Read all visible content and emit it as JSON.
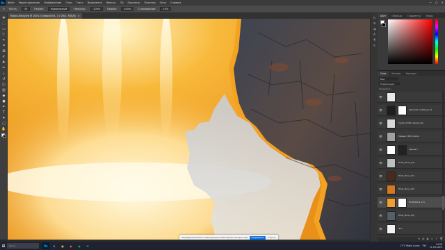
{
  "menubar": {
    "logo": "Ps",
    "items": [
      "Файл",
      "Редактирование",
      "Изображение",
      "Слои",
      "Текст",
      "Выделение",
      "Фильтр",
      "3D",
      "Просмотр",
      "Плагины",
      "Окно",
      "Справка"
    ],
    "controls": [
      "—",
      "▢",
      "✕"
    ]
  },
  "options": {
    "tool_label": "Кисть:",
    "size": "35",
    "mode_label": "Режим:",
    "mode": "Нормальный",
    "opacity_label": "Непрозр.:",
    "opacity": "100%",
    "flow_label": "Нажим:",
    "flow": "100%",
    "smoothing_label": "Сглаживание:",
    "smoothing": "10%"
  },
  "document": {
    "tab_title": "Rodion-Bleloyard @ 100% (Снимок0004, 1:1 0001, RGB/8)",
    "close": "×"
  },
  "color_panel": {
    "tabs": [
      "Цвет",
      "Образцы",
      "Градиенты",
      "Узоры"
    ],
    "fg_color": "#ffffff",
    "bg_color": "#000000"
  },
  "layers_panel": {
    "tabs": [
      "Слои",
      "Каналы",
      "Контуры"
    ],
    "filter": "Вид",
    "blend_mode": "Нормальный",
    "lock_label": "Закрепить:",
    "layers": [
      {
        "name": "",
        "thumb": "#e9e9e9",
        "mask": "",
        "selected": false
      },
      {
        "name": "Цветовой тон/Насыщ 10",
        "thumb": "#1e1e1e",
        "mask": "#ffffff",
        "selected": false
      },
      {
        "name": "Группа 2 000_original color",
        "thumb": "#d8d8d8",
        "mask": "",
        "selected": false
      },
      {
        "name": "Кривые 1 000_original",
        "thumb": "#a0a0a0",
        "mask": "",
        "selected": false
      },
      {
        "name": "Кривые 1",
        "thumb": "#ffffff",
        "mask": "#222222",
        "selected": false
      },
      {
        "name": "Photo_Stone_1(4)",
        "thumb": "#c0c0c0",
        "mask": "",
        "selected": false
      },
      {
        "name": "Photo_Stone_1(5)",
        "thumb": "#4a2a18",
        "mask": "",
        "selected": false
      },
      {
        "name": "Photo_Stone_1(6)",
        "thumb": "#d27a22",
        "mask": "",
        "selected": false
      },
      {
        "name": "PhotoMarble_1(7)",
        "thumb": "#f0a030",
        "mask": "#ffffff",
        "selected": true
      },
      {
        "name": "Photo_Stone_1(8)",
        "thumb": "#56606c",
        "mask": "",
        "selected": false
      },
      {
        "name": "Фон",
        "thumb": "#f2f2f2",
        "mask": "",
        "selected": false
      }
    ],
    "footer_icons": [
      "fx",
      "◐",
      "▣",
      "▭",
      "＋",
      "🗑"
    ]
  },
  "notice": {
    "text": "Попробуйте бесплатно! Новая функция Adobe Express: быстрое создание видео",
    "primary": "Попробовать",
    "close": "Закрыть"
  },
  "taskbar": {
    "search": "Поиск",
    "apps": [
      {
        "label": "Ps",
        "color": "#31a8ff",
        "bg": "#001e36"
      },
      {
        "label": "e",
        "color": "#3fa9f5",
        "bg": "#1f2330"
      },
      {
        "label": "▣",
        "color": "#f5c542",
        "bg": "#1f2330"
      },
      {
        "label": "●",
        "color": "#e34c26",
        "bg": "#1f2330"
      },
      {
        "label": "◉",
        "color": "#4caf50",
        "bg": "#1f2330"
      },
      {
        "label": "✉",
        "color": "#58a6ff",
        "bg": "#1f2330"
      }
    ],
    "weather": "17°C Partly sunny",
    "lang": "РУС",
    "time": "14:29",
    "date": "11.09.2023"
  }
}
